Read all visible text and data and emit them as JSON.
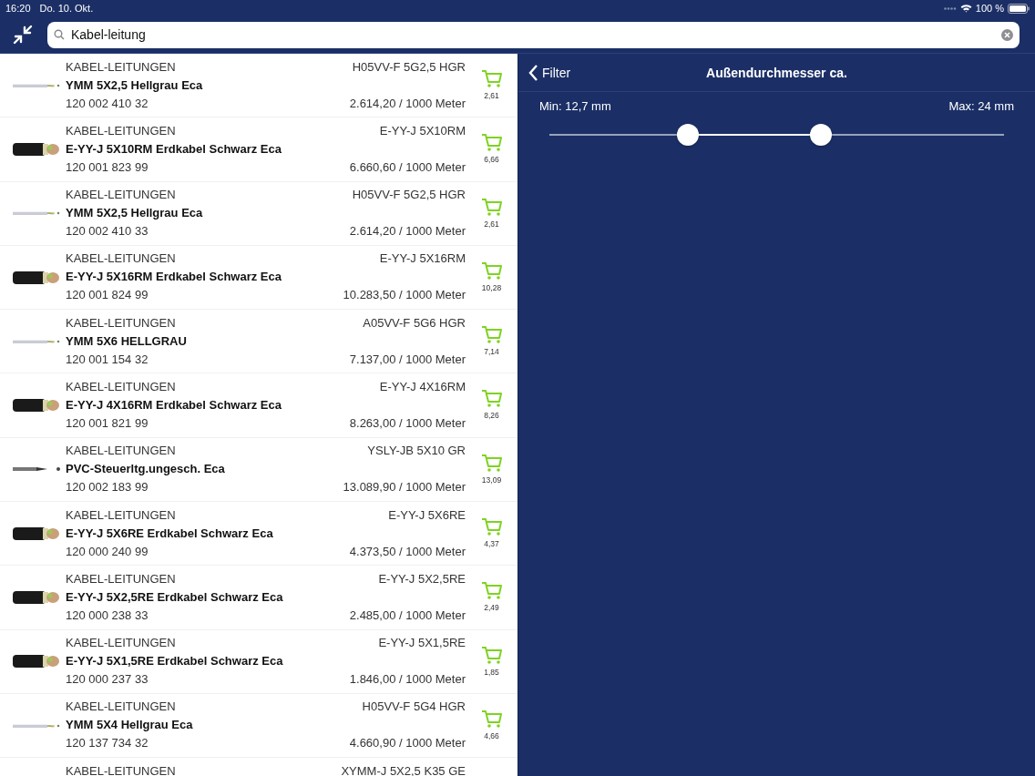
{
  "status_bar": {
    "time": "16:20",
    "date": "Do. 10. Okt.",
    "battery": "100 %"
  },
  "search": {
    "value": "Kabel-leitung"
  },
  "results": [
    {
      "kind": "grey",
      "category": "KABEL-LEITUNGEN",
      "code": "H05VV-F 5G2,5 HGR",
      "name": "YMM 5X2,5 Hellgrau Eca",
      "number": "120 002 410 32",
      "price": "2.614,20 / 1000 Meter",
      "cart_value": "2,61"
    },
    {
      "kind": "black",
      "category": "KABEL-LEITUNGEN",
      "code": "E-YY-J 5X10RM",
      "name": "E-YY-J 5X10RM Erdkabel Schwarz Eca",
      "number": "120 001 823 99",
      "price": "6.660,60 / 1000 Meter",
      "cart_value": "6,66"
    },
    {
      "kind": "grey",
      "category": "KABEL-LEITUNGEN",
      "code": "H05VV-F 5G2,5 HGR",
      "name": "YMM 5X2,5 Hellgrau Eca",
      "number": "120 002 410 33",
      "price": "2.614,20 / 1000 Meter",
      "cart_value": "2,61"
    },
    {
      "kind": "black",
      "category": "KABEL-LEITUNGEN",
      "code": "E-YY-J 5X16RM",
      "name": "E-YY-J 5X16RM Erdkabel Schwarz Eca",
      "number": "120 001 824 99",
      "price": "10.283,50 / 1000 Meter",
      "cart_value": "10,28"
    },
    {
      "kind": "grey",
      "category": "KABEL-LEITUNGEN",
      "code": "A05VV-F 5G6 HGR",
      "name": "YMM 5X6 HELLGRAU",
      "number": "120 001 154 32",
      "price": "7.137,00 / 1000 Meter",
      "cart_value": "7,14"
    },
    {
      "kind": "black",
      "category": "KABEL-LEITUNGEN",
      "code": "E-YY-J 4X16RM",
      "name": "E-YY-J 4X16RM Erdkabel Schwarz Eca",
      "number": "120 001 821 99",
      "price": "8.263,00 / 1000 Meter",
      "cart_value": "8,26"
    },
    {
      "kind": "thin",
      "category": "KABEL-LEITUNGEN",
      "code": "YSLY-JB 5X10 GR",
      "name": "PVC-Steuerltg.ungesch. Eca",
      "number": "120 002 183 99",
      "price": "13.089,90 / 1000 Meter",
      "cart_value": "13,09"
    },
    {
      "kind": "black",
      "category": "KABEL-LEITUNGEN",
      "code": "E-YY-J 5X6RE",
      "name": "E-YY-J 5X6RE Erdkabel Schwarz Eca",
      "number": "120 000 240 99",
      "price": "4.373,50 / 1000 Meter",
      "cart_value": "4,37"
    },
    {
      "kind": "black",
      "category": "KABEL-LEITUNGEN",
      "code": "E-YY-J 5X2,5RE",
      "name": "E-YY-J 5X2,5RE Erdkabel Schwarz Eca",
      "number": "120 000 238 33",
      "price": "2.485,00 / 1000 Meter",
      "cart_value": "2,49"
    },
    {
      "kind": "black",
      "category": "KABEL-LEITUNGEN",
      "code": "E-YY-J 5X1,5RE",
      "name": "E-YY-J 5X1,5RE Erdkabel Schwarz Eca",
      "number": "120 000 237 33",
      "price": "1.846,00 / 1000 Meter",
      "cart_value": "1,85"
    },
    {
      "kind": "grey",
      "category": "KABEL-LEITUNGEN",
      "code": "H05VV-F 5G4 HGR",
      "name": "YMM 5X4 Hellgrau Eca",
      "number": "120 137 734 32",
      "price": "4.660,90 / 1000 Meter",
      "cart_value": "4,66"
    },
    {
      "kind": "partial",
      "category": "KABEL-LEITUNGEN",
      "code": "XYMM-J 5X2,5 K35 GE"
    }
  ],
  "filter": {
    "back": "Filter",
    "title": "Außendurchmesser ca.",
    "min_label": "Min: 12,7 mm",
    "max_label": "Max: 24 mm",
    "min_thumb": {
      "level": 0.305
    },
    "max_thumb": {
      "level": 0.597
    }
  }
}
